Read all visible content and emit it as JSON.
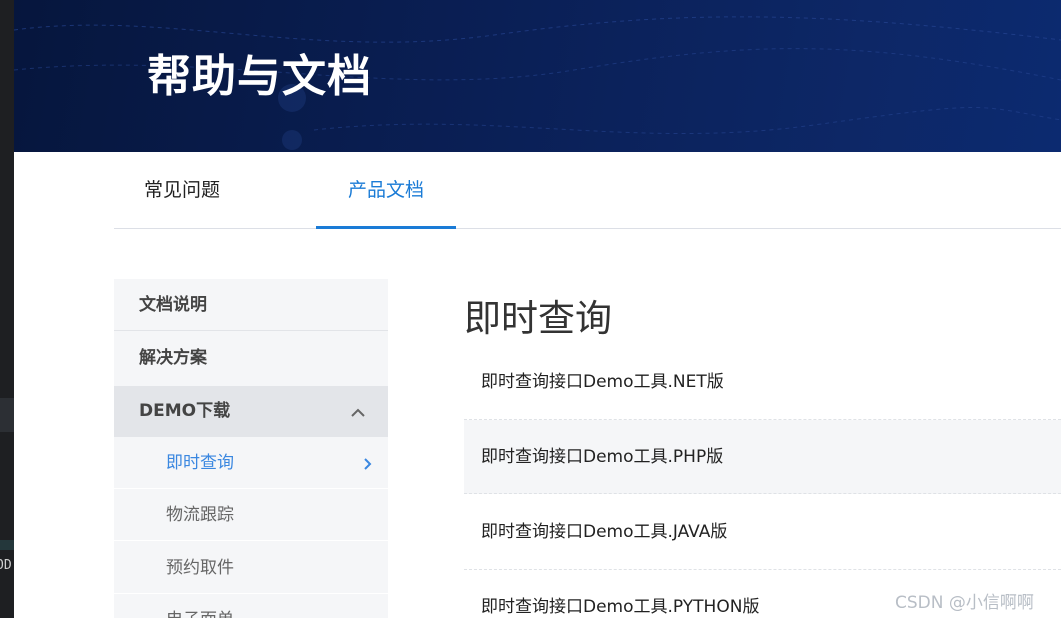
{
  "banner": {
    "title": "帮助与文档"
  },
  "tabs": [
    {
      "label": "常见问题",
      "active": false
    },
    {
      "label": "产品文档",
      "active": true
    }
  ],
  "sidebar": {
    "items": [
      {
        "label": "文档说明"
      },
      {
        "label": "解决方案"
      },
      {
        "label": "DEMO下载",
        "expanded": true,
        "icon": "chevron-up-icon",
        "children": [
          {
            "label": "即时查询",
            "active": true,
            "icon": "chevron-right-icon"
          },
          {
            "label": "物流跟踪"
          },
          {
            "label": "预约取件"
          },
          {
            "label": "电子面单"
          }
        ]
      }
    ]
  },
  "content": {
    "title": "即时查询",
    "rows": [
      "即时查询接口Demo工具.NET版",
      "即时查询接口Demo工具.PHP版",
      "即时查询接口Demo工具.JAVA版",
      "即时查询接口Demo工具.PYTHON版"
    ]
  },
  "watermark": "CSDN @小信啊啊",
  "edge_text": "OD",
  "colors": {
    "accent": "#1a7bd6",
    "banner": "#0a1f55",
    "sidebar_bg": "#f5f6f8"
  }
}
